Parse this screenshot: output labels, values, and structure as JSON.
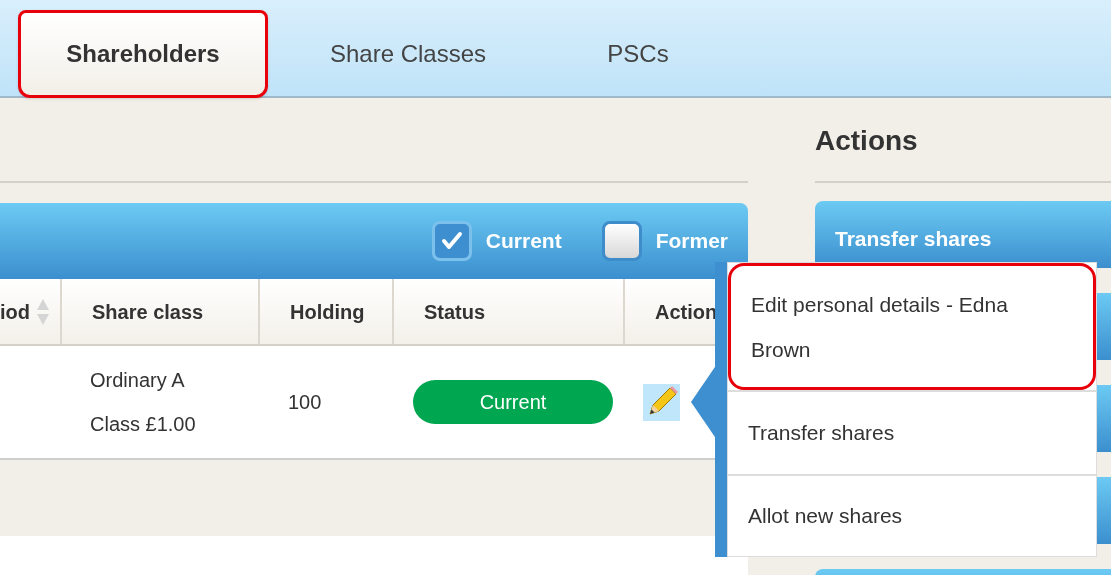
{
  "tabs": [
    {
      "label": "Shareholders",
      "selected": true,
      "highlighted": true
    },
    {
      "label": "Share Classes",
      "selected": false,
      "highlighted": false
    },
    {
      "label": "PSCs",
      "selected": false,
      "highlighted": false
    }
  ],
  "table": {
    "filters": [
      {
        "label": "Current",
        "checked": true
      },
      {
        "label": "Former",
        "checked": false
      }
    ],
    "columns": [
      {
        "label": "iod",
        "sortable": true
      },
      {
        "label": "Share class"
      },
      {
        "label": "Holding"
      },
      {
        "label": "Status"
      },
      {
        "label": "Action"
      }
    ],
    "rows": [
      {
        "share_class": "Ordinary A Class £1.00",
        "holding": "100",
        "status": "Current"
      }
    ]
  },
  "actions_panel": {
    "title": "Actions",
    "buttons": [
      {
        "label": "Transfer shares"
      }
    ]
  },
  "action_menu": {
    "items": [
      {
        "label": "Edit personal details - Edna Brown",
        "highlighted": true
      },
      {
        "label": "Transfer shares",
        "highlighted": false
      },
      {
        "label": "Allot new shares",
        "highlighted": false
      }
    ]
  }
}
